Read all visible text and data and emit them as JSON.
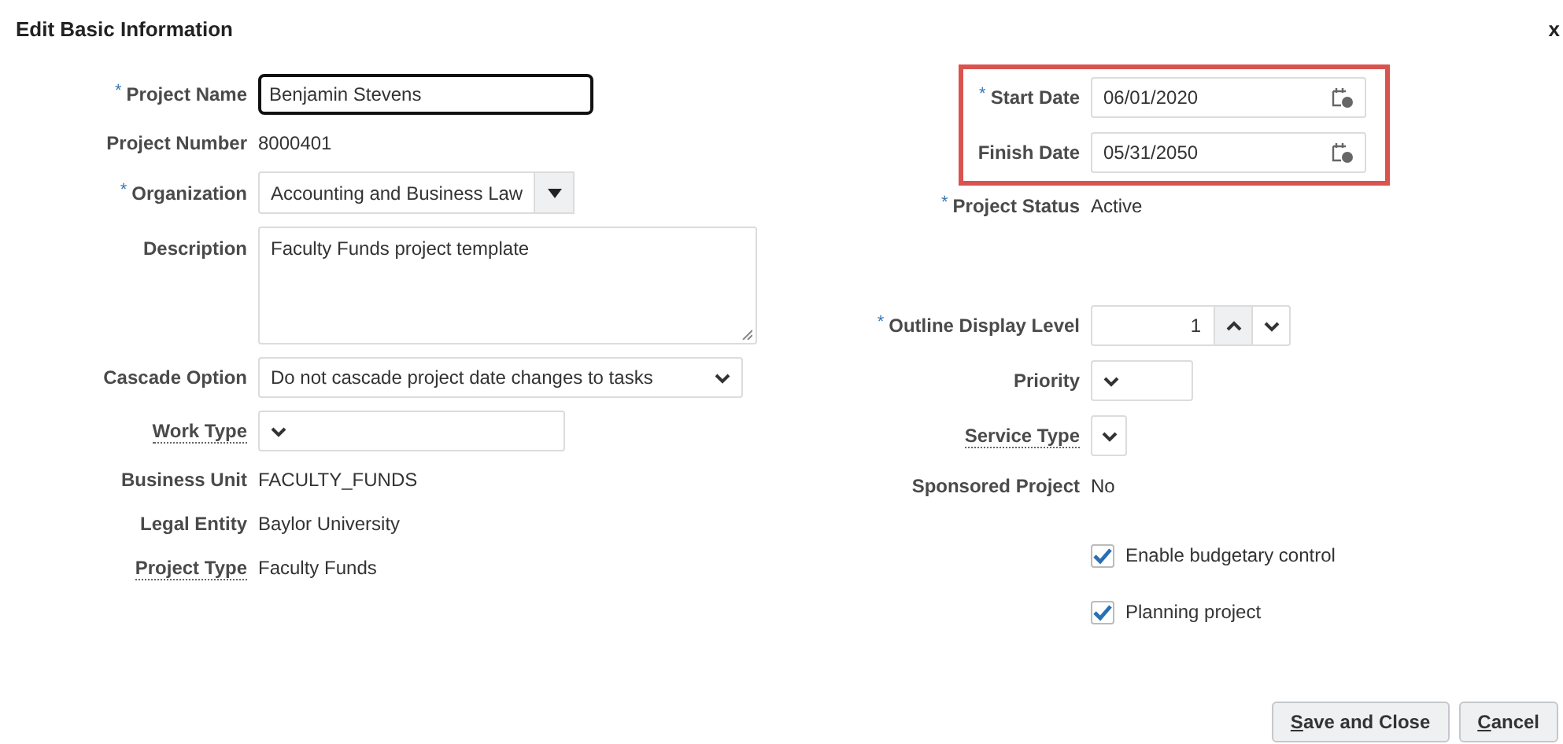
{
  "dialog": {
    "title": "Edit Basic Information",
    "close": "x"
  },
  "left_fields": [
    {
      "kind": "input",
      "label": "Project Name",
      "required": "*",
      "underlined": false,
      "value": "Benjamin Stevens",
      "focused": true
    },
    {
      "kind": "display",
      "label": "Project Number",
      "underlined": false,
      "value": "8000401"
    },
    {
      "kind": "choice",
      "label": "Organization",
      "required": "*",
      "underlined": false,
      "value": "Accounting and Business Law"
    },
    {
      "kind": "textarea",
      "label": "Description",
      "underlined": false,
      "value": "Faculty Funds project template"
    },
    {
      "kind": "select",
      "label": "Cascade Option",
      "underlined": false,
      "value": "Do not cascade project date changes to tasks"
    },
    {
      "kind": "select",
      "label": "Work Type",
      "underlined": true
    },
    {
      "kind": "display",
      "label": "Business Unit",
      "underlined": false,
      "value": "FACULTY_FUNDS"
    },
    {
      "kind": "display",
      "label": "Legal Entity",
      "underlined": false,
      "value": "Baylor University"
    },
    {
      "kind": "display",
      "label": "Project Type",
      "underlined": true,
      "value": "Faculty Funds"
    }
  ],
  "date_box": {
    "highlighted": true,
    "fields": [
      {
        "kind": "date",
        "label": "Start Date",
        "required": "*",
        "underlined": false,
        "value": "06/01/2020"
      },
      {
        "kind": "date",
        "label": "Finish Date",
        "underlined": false,
        "value": "05/31/2050"
      }
    ]
  },
  "right_fields": [
    {
      "kind": "display",
      "label": "Project Status",
      "required": "*",
      "underlined": false,
      "value": "Active"
    },
    {
      "kind": "spinner",
      "label": "Outline Display Level",
      "required": "*",
      "underlined": false,
      "value": "1"
    },
    {
      "kind": "select",
      "label": "Priority",
      "underlined": false
    },
    {
      "kind": "select",
      "label": "Service Type",
      "underlined": true
    },
    {
      "kind": "display",
      "label": "Sponsored Project",
      "underlined": false,
      "value": "No"
    },
    {
      "kind": "checkbox",
      "label": "Enable budgetary control",
      "checked": true
    },
    {
      "kind": "checkbox",
      "label": "Planning project",
      "checked": true
    }
  ],
  "buttons": [
    {
      "label": "Save and Close",
      "mnemonic_first": true
    },
    {
      "label": "Cancel",
      "mnemonic_first": true
    }
  ]
}
